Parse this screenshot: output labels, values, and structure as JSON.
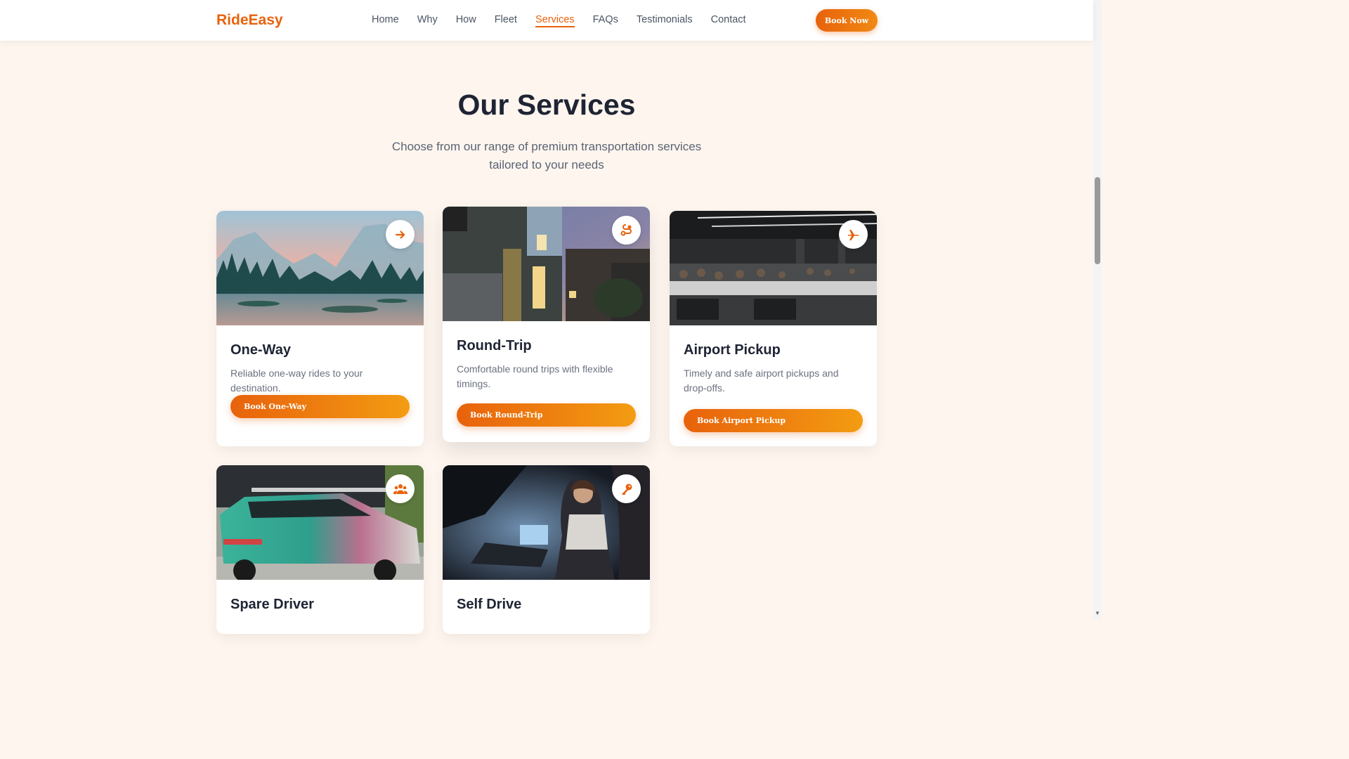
{
  "nav": {
    "logo": "RideEasy",
    "items": [
      "Home",
      "Why",
      "How",
      "Fleet",
      "Services",
      "FAQs",
      "Testimonials",
      "Contact"
    ],
    "active": "Services",
    "cta": "Book Now"
  },
  "section": {
    "title": "Our Services",
    "subtitle": "Choose from our range of premium transportation services tailored to your needs"
  },
  "services": [
    {
      "title": "One-Way",
      "description": "Reliable one-way rides to your destination.",
      "button": "Book One-Way",
      "icon": "arrow-right-icon",
      "image": "mountain lake forest landscape"
    },
    {
      "title": "Round-Trip",
      "description": "Comfortable round trips with flexible timings.",
      "button": "Book Round-Trip",
      "icon": "route-icon",
      "image": "modern house at dusk"
    },
    {
      "title": "Airport Pickup",
      "description": "Timely and safe airport pickups and drop-offs.",
      "button": "Book Airport Pickup",
      "icon": "plane-icon",
      "image": "open office workspace"
    },
    {
      "title": "Spare Driver",
      "icon": "users-icon",
      "image": "self-driving car on street"
    },
    {
      "title": "Self Drive",
      "icon": "key-icon",
      "image": "woman working inside car"
    }
  ],
  "colors": {
    "accent": "#e8620c",
    "accent_light": "#f39c12",
    "background": "#fdf5ee",
    "heading": "#1e2434"
  }
}
